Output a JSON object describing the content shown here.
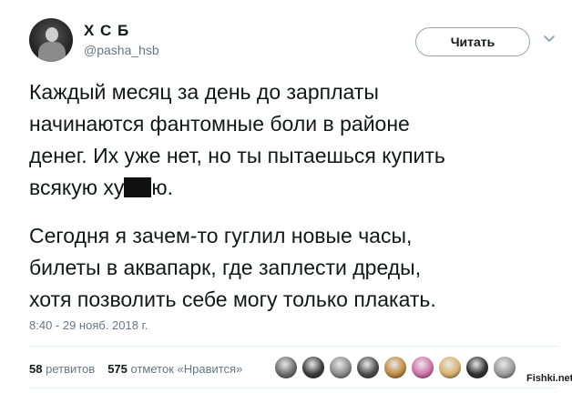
{
  "author": {
    "avatar_caption": "",
    "name": "Х С Б",
    "handle": "@pasha_hsb"
  },
  "actions": {
    "follow_label": "Читать",
    "menu_icon": "chevron-down-icon"
  },
  "tweet": {
    "lines_p1": [
      "Каждый месяц за день до зарплаты",
      "начинаются фантомные боли в районе",
      "денег. Их уже нет, но ты пытаешься купить"
    ],
    "line4_start": "всякую ху",
    "line4_end": "ю.",
    "lines_p2": [
      "Сегодня я зачем-то гуглил новые часы,",
      "билеты в аквапарк, где заплести дреды,",
      "хотя позволить себе могу только плакать."
    ],
    "timestamp": "8:40 - 29 нояб. 2018 г."
  },
  "stats": {
    "retweets_count": "58",
    "retweets_label": "ретвитов",
    "likes_count": "575",
    "likes_label": "отметок «Нравится»"
  },
  "likers": [
    {
      "name": "liker-1",
      "color": "#6b6b6b"
    },
    {
      "name": "liker-2",
      "color": "#3a3a3a"
    },
    {
      "name": "liker-3",
      "color": "#8a8a8a"
    },
    {
      "name": "liker-4",
      "color": "#4a4a4a"
    },
    {
      "name": "liker-5",
      "color": "#c08a3e"
    },
    {
      "name": "liker-6",
      "color": "#d06fa8"
    },
    {
      "name": "liker-7",
      "color": "#d9b26b"
    },
    {
      "name": "liker-8",
      "color": "#2f2f2f"
    },
    {
      "name": "liker-9",
      "color": "#9a9a9a"
    }
  ],
  "watermark": "Fishki.net"
}
